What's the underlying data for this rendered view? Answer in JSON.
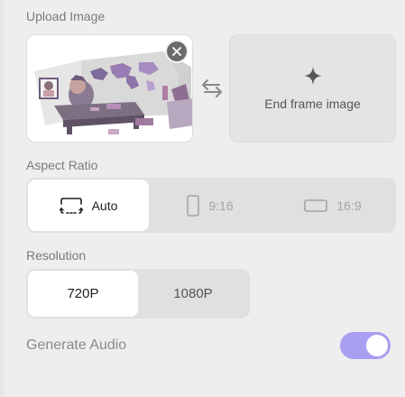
{
  "upload": {
    "label": "Upload Image",
    "end_frame_label": "End frame image"
  },
  "aspect_ratio": {
    "label": "Aspect Ratio",
    "options": [
      {
        "label": "Auto",
        "selected": true
      },
      {
        "label": "9:16",
        "selected": false
      },
      {
        "label": "16:9",
        "selected": false
      }
    ]
  },
  "resolution": {
    "label": "Resolution",
    "options": [
      {
        "label": "720P",
        "selected": true
      },
      {
        "label": "1080P",
        "selected": false
      }
    ]
  },
  "audio": {
    "label": "Generate Audio",
    "enabled": true
  },
  "colors": {
    "toggle_on": "#a99ff0",
    "panel_bg": "#eeeeee"
  }
}
